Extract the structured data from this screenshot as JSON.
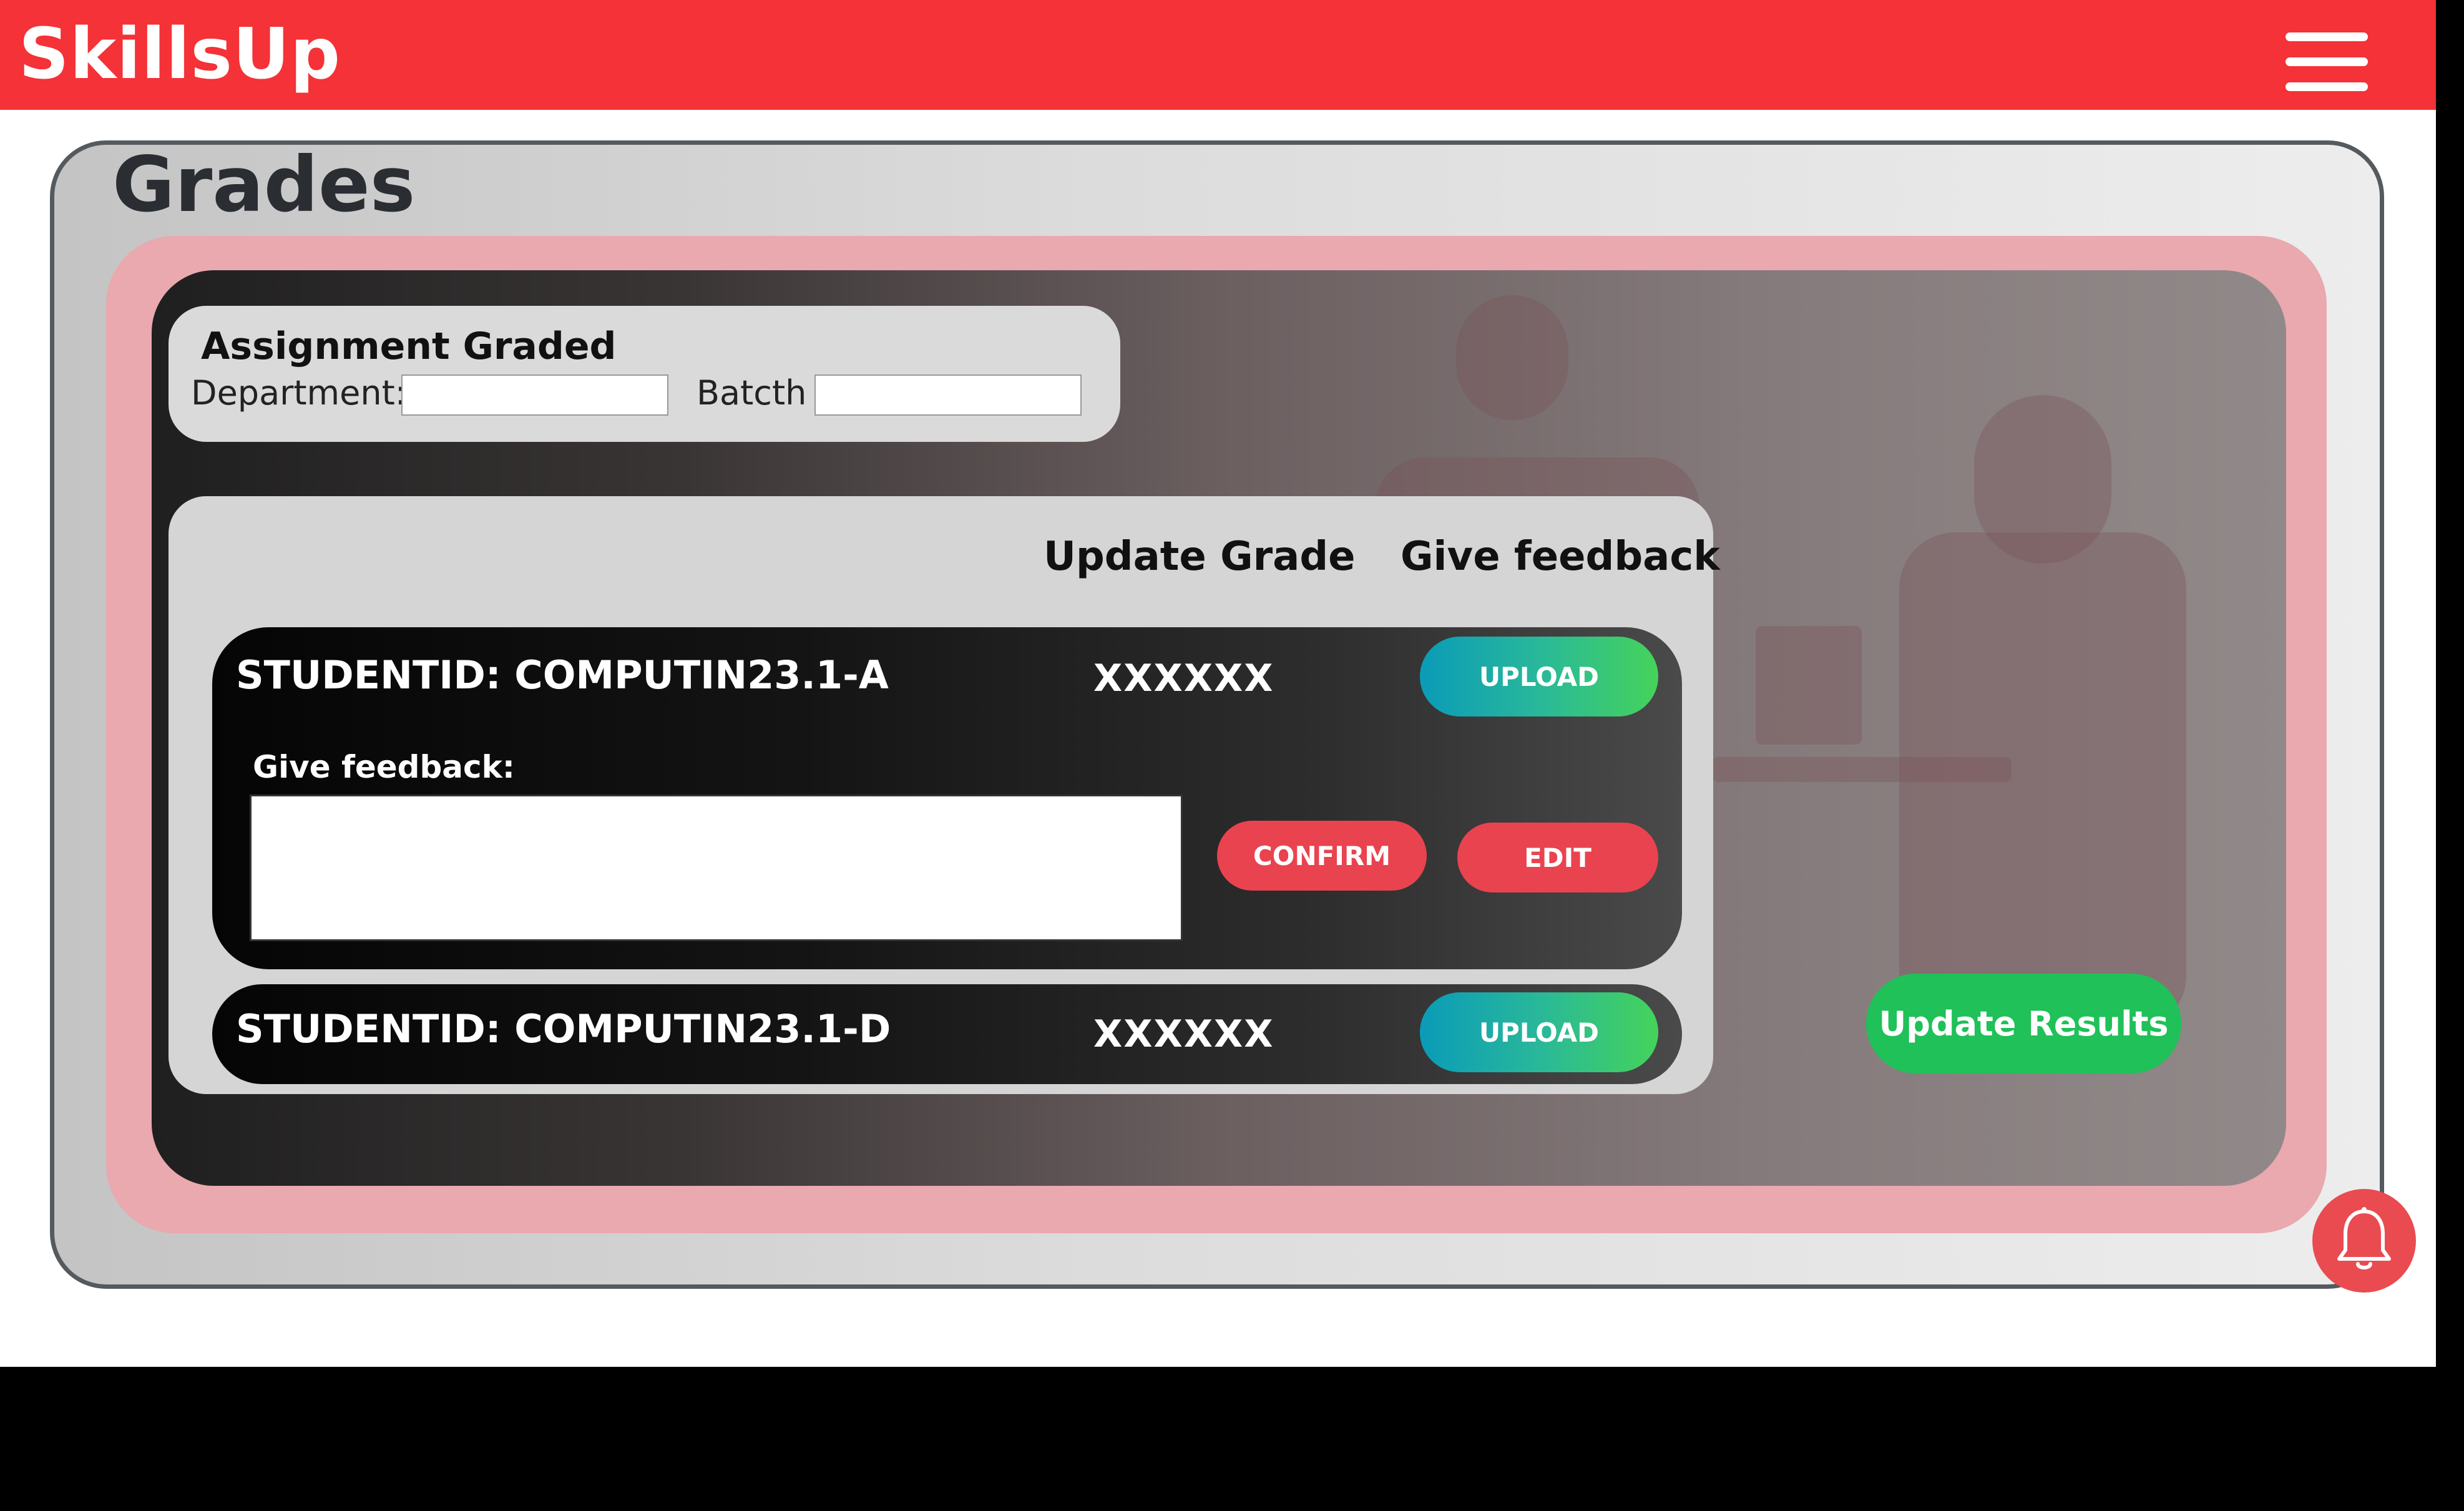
{
  "app": {
    "brand": "SkillsUp",
    "menu_icon": "hamburger-menu-icon"
  },
  "page": {
    "title": "Grades"
  },
  "assignment": {
    "title": "Assignment Graded",
    "department_label": "Department:",
    "department_value": "",
    "batch_label": "Batcth",
    "batch_value": ""
  },
  "table": {
    "headers": {
      "update_grade": "Update Grade",
      "give_feedback": "Give feedback"
    },
    "rows": [
      {
        "student_id": "STUDENTID: COMPUTIN23.1-A",
        "grade": "XXXXXX",
        "upload_label": "UPLOAD",
        "feedback_label": "Give feedback:",
        "feedback_value": "",
        "confirm_label": "CONFIRM",
        "edit_label": "EDIT"
      },
      {
        "student_id": "STUDENTID: COMPUTIN23.1-D",
        "grade": "XXXXXX",
        "upload_label": "UPLOAD"
      }
    ]
  },
  "actions": {
    "update_results": "Update Results",
    "notification_icon": "bell-icon"
  },
  "colors": {
    "header": "#f43237",
    "upload_gradient_start": "#0a9bb8",
    "upload_gradient_end": "#45d35a",
    "red_button": "#e9434f",
    "update_button": "#1fc158"
  }
}
